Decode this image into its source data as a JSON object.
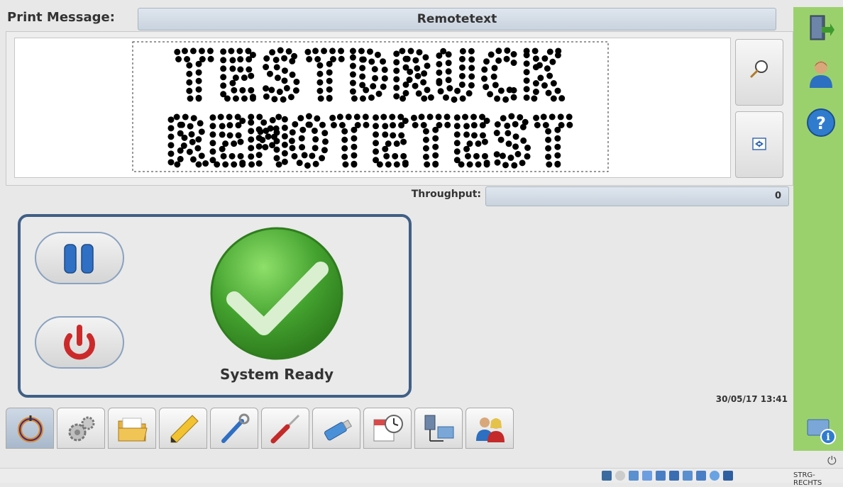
{
  "header": {
    "label": "Print Message:",
    "message_name": "Remotetext"
  },
  "preview": {
    "line1": "TESTDRUCK",
    "line2": "REMOTETEST"
  },
  "throughput": {
    "label": "Throughput:",
    "value": "0"
  },
  "status": {
    "text": "System Ready"
  },
  "datetime": "30/05/17 13:41",
  "taskbar": {
    "hotkey": "STRG-RECHTS"
  },
  "icons": {
    "zoom": "magnifier-icon",
    "fit": "fit-to-screen-icon",
    "pause": "pause-icon",
    "power": "power-icon",
    "ready": "checkmark-icon",
    "exit": "exit-door-icon",
    "user": "user-icon",
    "help": "help-icon",
    "info": "monitor-info-icon"
  },
  "tabs": [
    {
      "name": "print-tab-icon"
    },
    {
      "name": "settings-gears-icon"
    },
    {
      "name": "folder-icon"
    },
    {
      "name": "pencil-icon"
    },
    {
      "name": "wrench-screwdriver-icon"
    },
    {
      "name": "screwdriver-icon"
    },
    {
      "name": "usb-stick-icon"
    },
    {
      "name": "calendar-clock-icon"
    },
    {
      "name": "network-computer-icon"
    },
    {
      "name": "users-icon"
    }
  ],
  "colors": {
    "accent_blue": "#3f5f86",
    "sidebar_green": "#9bd16d",
    "ready_green": "#43a12e",
    "power_red": "#cc2a2a"
  }
}
